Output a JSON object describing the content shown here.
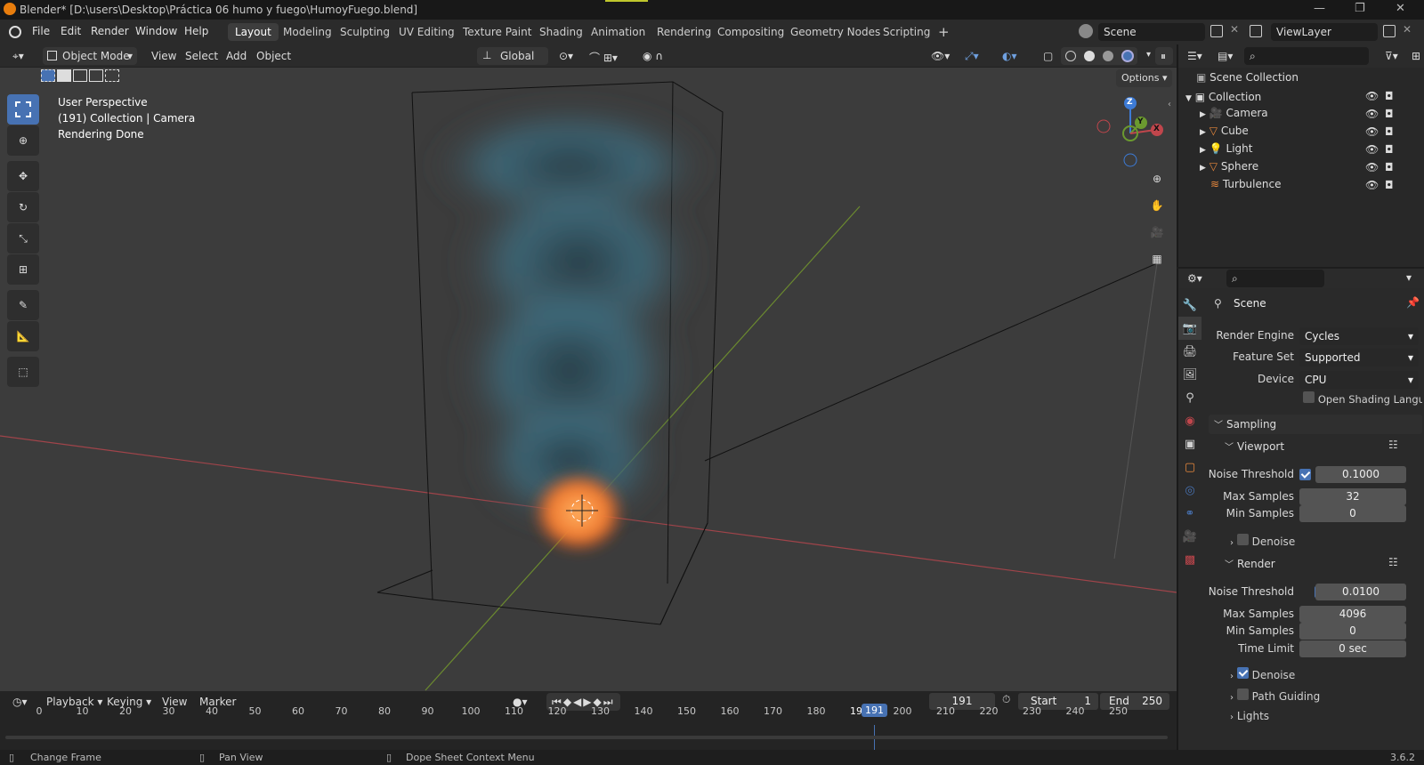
{
  "titlebar": {
    "title": "Blender* [D:\\users\\Desktop\\Práctica 06 humo y fuego\\HumoyFuego.blend]",
    "minimize": "—",
    "maximize": "❐",
    "close": "✕"
  },
  "menus": [
    "File",
    "Edit",
    "Render",
    "Window",
    "Help"
  ],
  "workspaces": [
    "Layout",
    "Modeling",
    "Sculpting",
    "UV Editing",
    "Texture Paint",
    "Shading",
    "Animation",
    "Rendering",
    "Compositing",
    "Geometry Nodes",
    "Scripting"
  ],
  "workspace_add": "+",
  "scene": {
    "label": "Scene",
    "viewlayer": "ViewLayer"
  },
  "viewport_header": {
    "mode": "Object Mode",
    "menus": [
      "View",
      "Select",
      "Add",
      "Object"
    ],
    "orientation": "Global",
    "options": "Options"
  },
  "overlay": {
    "line1": "User Perspective",
    "line2": "(191) Collection | Camera",
    "line3": "Rendering Done"
  },
  "gizmo": {
    "z": "Z",
    "y": "Y",
    "x": "X"
  },
  "outliner": {
    "scene_collection": "Scene Collection",
    "collection": "Collection",
    "items": [
      {
        "name": "Camera",
        "icon": "camera-icon"
      },
      {
        "name": "Cube",
        "icon": "mesh-icon"
      },
      {
        "name": "Light",
        "icon": "light-icon"
      },
      {
        "name": "Sphere",
        "icon": "mesh-icon"
      },
      {
        "name": "Turbulence",
        "icon": "force-field-icon"
      }
    ]
  },
  "properties": {
    "context": "Scene",
    "render_engine_label": "Render Engine",
    "render_engine": "Cycles",
    "feature_set_label": "Feature Set",
    "feature_set": "Supported",
    "device_label": "Device",
    "device": "CPU",
    "osl_label": "Open Shading Langu...",
    "sampling": "Sampling",
    "viewport": {
      "title": "Viewport",
      "noise_threshold_label": "Noise Threshold",
      "noise_threshold": "0.1000",
      "noise_threshold_enabled": true,
      "max_samples_label": "Max Samples",
      "max_samples": "32",
      "min_samples_label": "Min Samples",
      "min_samples": "0",
      "denoise_label": "Denoise",
      "denoise": false
    },
    "render": {
      "title": "Render",
      "noise_threshold_label": "Noise Threshold",
      "noise_threshold": "0.0100",
      "noise_threshold_enabled": true,
      "max_samples_label": "Max Samples",
      "max_samples": "4096",
      "min_samples_label": "Min Samples",
      "min_samples": "0",
      "time_limit_label": "Time Limit",
      "time_limit": "0 sec",
      "denoise_label": "Denoise",
      "denoise": true
    },
    "path_guiding": "Path Guiding",
    "lights": "Lights"
  },
  "timeline": {
    "menus": [
      "Playback",
      "Keying",
      "View",
      "Marker"
    ],
    "current_frame": "191",
    "start_label": "Start",
    "start": "1",
    "end_label": "End",
    "end": "250",
    "ticks": [
      "0",
      "10",
      "20",
      "30",
      "40",
      "50",
      "60",
      "70",
      "80",
      "90",
      "100",
      "110",
      "120",
      "130",
      "140",
      "150",
      "160",
      "170",
      "180",
      "190",
      "200",
      "210",
      "220",
      "230",
      "240",
      "250"
    ]
  },
  "statusbar": {
    "item1": "Change Frame",
    "item2": "Pan View",
    "item3": "Dope Sheet Context Menu",
    "version": "3.6.2"
  },
  "colors": {
    "accent": "#4772b3",
    "axis_x": "#c0464c",
    "axis_y": "#6b9a2f",
    "axis_z": "#3d7bd6",
    "fire": "#f07a30",
    "smoke": "#3f6e80"
  }
}
